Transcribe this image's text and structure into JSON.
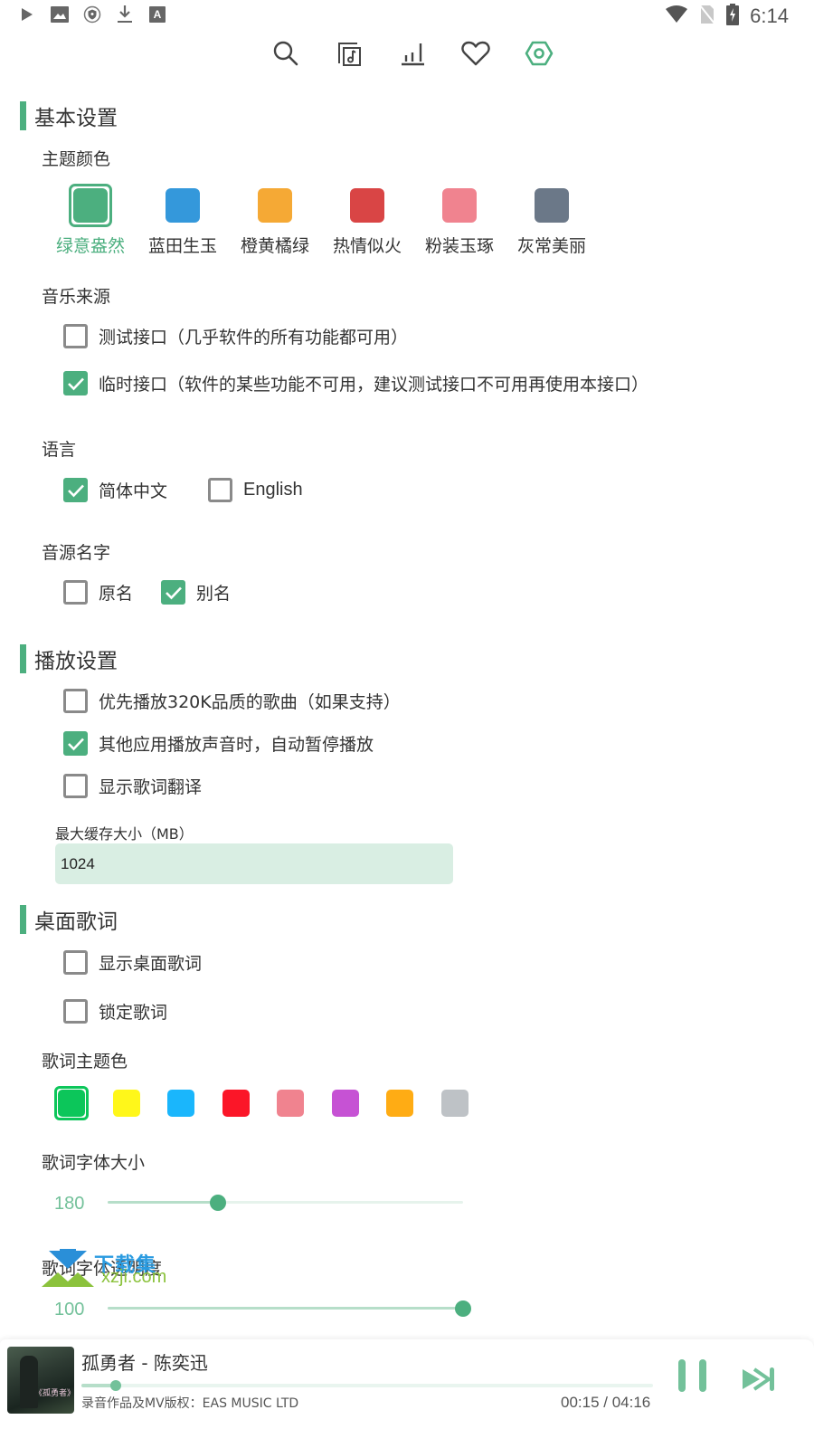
{
  "status_bar": {
    "left_icons": [
      "play-icon",
      "image-icon",
      "vpn-shield-icon",
      "download-icon",
      "font-icon"
    ],
    "right_icons": [
      "wifi-icon",
      "no-sim-icon",
      "battery-charging-icon"
    ],
    "time": "6:14"
  },
  "top_nav": {
    "items": [
      {
        "icon": "search-icon",
        "active": false
      },
      {
        "icon": "music-library-icon",
        "active": false
      },
      {
        "icon": "chart-icon",
        "active": false
      },
      {
        "icon": "heart-icon",
        "active": false
      },
      {
        "icon": "settings-hexagon-icon",
        "active": true
      }
    ],
    "accent_color": "#4caf7f"
  },
  "basic_settings": {
    "title": "基本设置",
    "theme_color": {
      "label": "主题颜色",
      "options": [
        {
          "name": "绿意盎然",
          "color": "#4caf7f",
          "selected": true
        },
        {
          "name": "蓝田生玉",
          "color": "#3498db",
          "selected": false
        },
        {
          "name": "橙黄橘绿",
          "color": "#f5a935",
          "selected": false
        },
        {
          "name": "热情似火",
          "color": "#d94545",
          "selected": false
        },
        {
          "name": "粉装玉琢",
          "color": "#f0838f",
          "selected": false
        },
        {
          "name": "灰常美丽",
          "color": "#6b7888",
          "selected": false
        }
      ]
    },
    "music_source": {
      "label": "音乐来源",
      "options": [
        {
          "label": "测试接口（几乎软件的所有功能都可用）",
          "checked": false
        },
        {
          "label": "临时接口（软件的某些功能不可用，建议测试接口不可用再使用本接口）",
          "checked": true
        }
      ]
    },
    "language": {
      "label": "语言",
      "options": [
        {
          "label": "简体中文",
          "checked": true
        },
        {
          "label": "English",
          "checked": false
        }
      ]
    },
    "source_name": {
      "label": "音源名字",
      "options": [
        {
          "label": "原名",
          "checked": false
        },
        {
          "label": "别名",
          "checked": true
        }
      ]
    }
  },
  "play_settings": {
    "title": "播放设置",
    "options": [
      {
        "label": "优先播放320K品质的歌曲（如果支持）",
        "checked": false
      },
      {
        "label": "其他应用播放声音时，自动暂停播放",
        "checked": true
      },
      {
        "label": "显示歌词翻译",
        "checked": false
      }
    ],
    "cache": {
      "label": "最大缓存大小（MB）",
      "value": "1024"
    }
  },
  "desktop_lyrics": {
    "title": "桌面歌词",
    "options": [
      {
        "label": "显示桌面歌词",
        "checked": false
      },
      {
        "label": "锁定歌词",
        "checked": false
      }
    ],
    "lyric_color": {
      "label": "歌词主题色",
      "options": [
        {
          "color": "#0cc65a",
          "selected": true
        },
        {
          "color": "#fff71a",
          "selected": false
        },
        {
          "color": "#1ab6fc",
          "selected": false
        },
        {
          "color": "#fb1628",
          "selected": false
        },
        {
          "color": "#f0838f",
          "selected": false
        },
        {
          "color": "#c652d4",
          "selected": false
        },
        {
          "color": "#ffac14",
          "selected": false
        },
        {
          "color": "#bec2c6",
          "selected": false
        }
      ]
    },
    "font_size": {
      "label": "歌词字体大小",
      "value": "180",
      "fraction": 0.31
    },
    "opacity": {
      "label": "歌词字体透明度",
      "value": "100",
      "fraction": 1.0
    }
  },
  "watermark": {
    "text_cn": "下载集",
    "text_url": "xzji.com"
  },
  "player": {
    "song_title": "孤勇者 - 陈奕迅",
    "copyright": "录音作品及MV版权：EAS MUSIC LTD",
    "current_time": "00:15",
    "total_time": "04:16",
    "time_display": "00:15 / 04:16",
    "progress_fraction": 0.06,
    "cover_text": "《孤勇者》"
  }
}
